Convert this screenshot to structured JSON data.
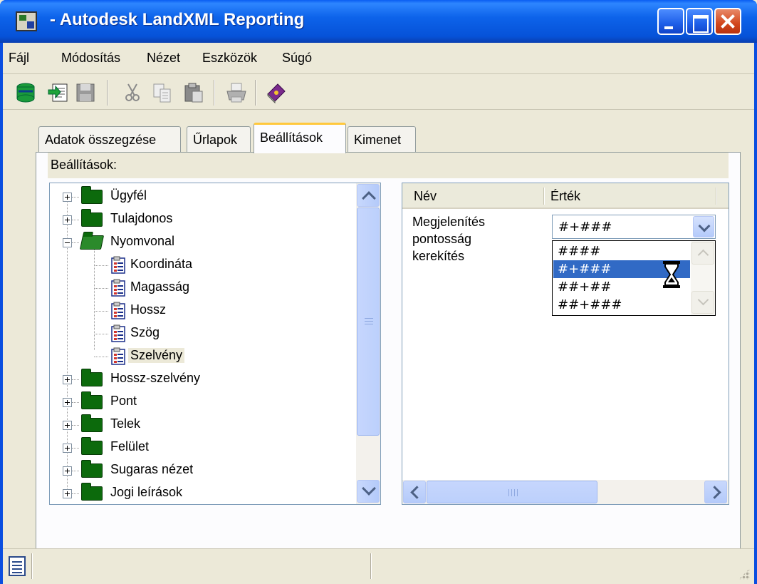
{
  "window": {
    "title": " - Autodesk LandXML Reporting"
  },
  "menu": {
    "items": [
      "Fájl",
      "Módosítás",
      "Nézet",
      "Eszközök",
      "Súgó"
    ]
  },
  "toolbar": {
    "icons": [
      "open-db-icon",
      "import-icon",
      "save-icon",
      "cut-icon",
      "copy-icon",
      "paste-icon",
      "print-icon",
      "help-book-icon"
    ]
  },
  "tabs": [
    {
      "label": "Adatok összegzése",
      "active": false
    },
    {
      "label": "Űrlapok",
      "active": false
    },
    {
      "label": "Beállítások",
      "active": true
    },
    {
      "label": "Kimenet",
      "active": false
    }
  ],
  "settings": {
    "section_label": "Beállítások:",
    "tree": [
      {
        "label": "Ügyfél",
        "type": "folder",
        "expanded": false
      },
      {
        "label": "Tulajdonos",
        "type": "folder",
        "expanded": false
      },
      {
        "label": "Nyomvonal",
        "type": "folder",
        "expanded": true
      },
      {
        "label": "Koordináta",
        "type": "item"
      },
      {
        "label": "Magasság",
        "type": "item"
      },
      {
        "label": "Hossz",
        "type": "item"
      },
      {
        "label": "Szög",
        "type": "item"
      },
      {
        "label": "Szelvény",
        "type": "item",
        "selected": true
      },
      {
        "label": "Hossz-szelvény",
        "type": "folder",
        "expanded": false
      },
      {
        "label": "Pont",
        "type": "folder",
        "expanded": false
      },
      {
        "label": "Telek",
        "type": "folder",
        "expanded": false
      },
      {
        "label": "Felület",
        "type": "folder",
        "expanded": false
      },
      {
        "label": "Sugaras nézet",
        "type": "folder",
        "expanded": false
      },
      {
        "label": "Jogi leírások",
        "type": "folder",
        "expanded": false
      }
    ],
    "grid": {
      "col_name": "Név",
      "col_value": "Érték",
      "property_lines": [
        "Megjelenítés",
        "pontosság",
        "kerekítés"
      ],
      "selected_value": "#+###",
      "options": [
        "####",
        "#+###",
        "##+##",
        "##+###"
      ],
      "highlighted_option": "#+###"
    }
  },
  "colors": {
    "title_bar": "#0a5df2",
    "selection": "#316ac5",
    "active_tab_accent": "#ffc83c",
    "folder": "#0c6a0c"
  }
}
